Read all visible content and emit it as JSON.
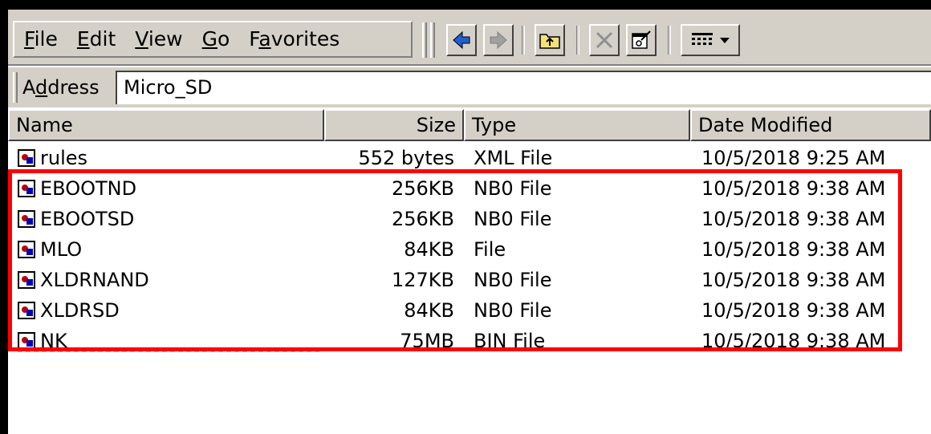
{
  "menu": {
    "file": {
      "acc": "F",
      "rest": "ile"
    },
    "edit": {
      "acc": "E",
      "rest": "dit"
    },
    "view": {
      "acc": "V",
      "rest": "iew"
    },
    "go": {
      "acc": "G",
      "rest": "o"
    },
    "favorites": {
      "pre": "F",
      "acc": "a",
      "rest": "vorites"
    }
  },
  "toolbar": {
    "icons": [
      "back-arrow-icon",
      "forward-arrow-icon",
      "up-folder-icon",
      "delete-icon",
      "properties-icon",
      "view-options-icon"
    ],
    "back_color": "#1f5fd0",
    "disabled_color": "#808080"
  },
  "address": {
    "label_pre": "A",
    "label_acc": "d",
    "label_rest": "dress",
    "value": "Micro_SD"
  },
  "columns": {
    "name": "Name",
    "size": "Size",
    "type": "Type",
    "date": "Date Modified"
  },
  "files": [
    {
      "name": "rules",
      "size": "552 bytes",
      "type": "XML File",
      "date": "10/5/2018 9:25 AM"
    },
    {
      "name": "EBOOTND",
      "size": "256KB",
      "type": "NB0 File",
      "date": "10/5/2018 9:38 AM"
    },
    {
      "name": "EBOOTSD",
      "size": "256KB",
      "type": "NB0 File",
      "date": "10/5/2018 9:38 AM"
    },
    {
      "name": "MLO",
      "size": "84KB",
      "type": "File",
      "date": "10/5/2018 9:38 AM"
    },
    {
      "name": "XLDRNAND",
      "size": "127KB",
      "type": "NB0 File",
      "date": "10/5/2018 9:38 AM"
    },
    {
      "name": "XLDRSD",
      "size": "84KB",
      "type": "NB0 File",
      "date": "10/5/2018 9:38 AM"
    },
    {
      "name": "NK",
      "size": "75MB",
      "type": "BIN File",
      "date": "10/5/2018 9:38 AM"
    }
  ],
  "highlight_color": "#ff0000"
}
